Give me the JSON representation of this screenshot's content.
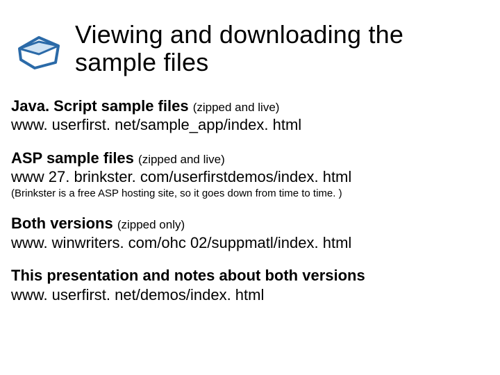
{
  "title": "Viewing and downloading the sample files",
  "sections": [
    {
      "label": "Java. Script sample files",
      "paren": "(zipped and live)",
      "url": "www. userfirst. net/sample_app/index. html",
      "note": ""
    },
    {
      "label": "ASP sample files",
      "paren": "(zipped and live)",
      "url": "www 27. brinkster. com/userfirstdemos/index. html",
      "note": "(Brinkster is a free ASP hosting site, so it goes down from time to time. )"
    },
    {
      "label": "Both versions",
      "paren": "(zipped only)",
      "url": "www. winwriters. com/ohc 02/suppmatl/index. html",
      "note": ""
    },
    {
      "label": "This presentation and notes about both versions",
      "paren": "",
      "url": "www. userfirst. net/demos/index. html",
      "note": ""
    }
  ]
}
